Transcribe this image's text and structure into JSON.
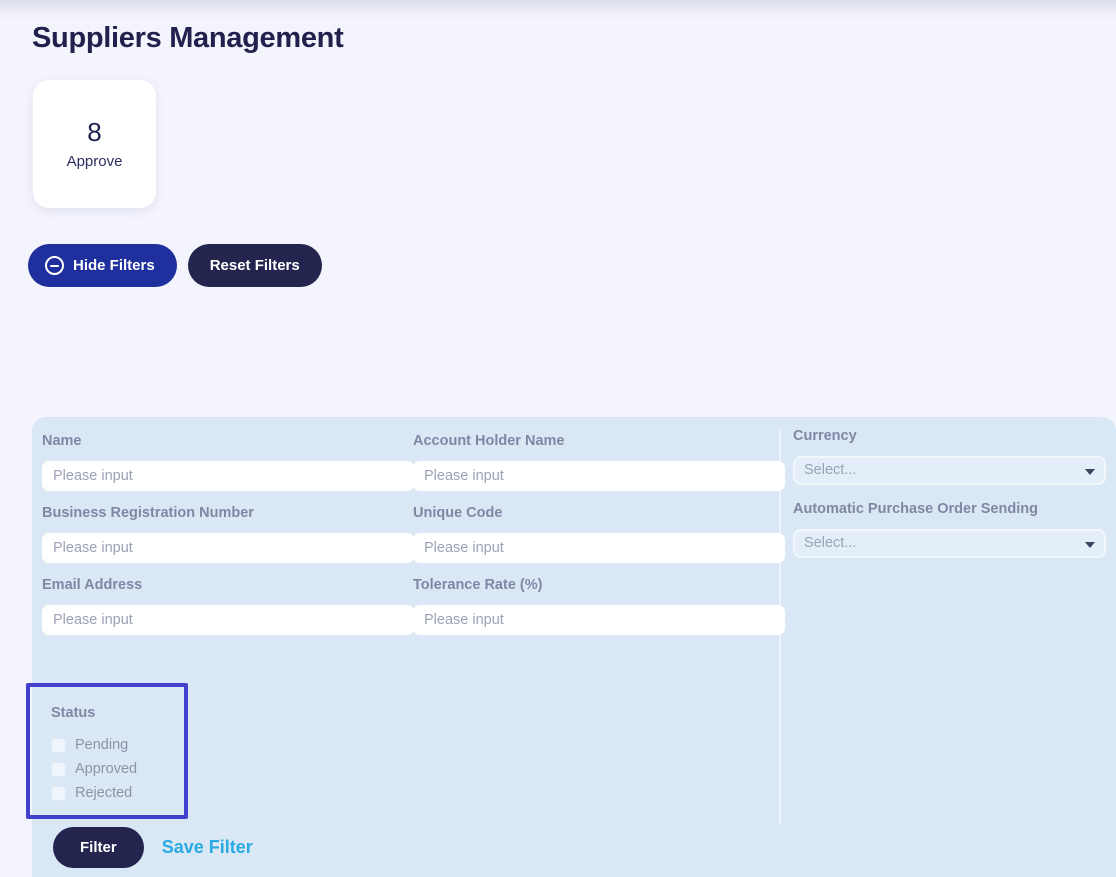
{
  "page": {
    "title": "Suppliers Management",
    "background_color": "#f4f4fd"
  },
  "stats": [
    {
      "value": "8",
      "label": "Approve"
    }
  ],
  "toolbar": {
    "hide_filters_label": "Hide Filters",
    "hide_filters_icon": "circle-minus-icon",
    "reset_filters_label": "Reset Filters",
    "hide_filters_color": "#1f2f9e",
    "reset_filters_color": "#23254f"
  },
  "filters": {
    "panel_color": "#dae8f6",
    "left_column": [
      {
        "label": "Name",
        "placeholder": "Please input",
        "value": ""
      },
      {
        "label": "Business Registration Number",
        "placeholder": "Please input",
        "value": ""
      },
      {
        "label": "Email Address",
        "placeholder": "Please input",
        "value": ""
      }
    ],
    "middle_column": [
      {
        "label": "Account Holder Name",
        "placeholder": "Please input",
        "value": ""
      },
      {
        "label": "Unique Code",
        "placeholder": "Please input",
        "value": ""
      },
      {
        "label": "Tolerance Rate (%)",
        "placeholder": "Please input",
        "value": ""
      }
    ],
    "right_column": [
      {
        "label": "Currency",
        "selected": "Select...",
        "icon": "chevron-down-icon"
      },
      {
        "label": "Automatic Purchase Order Sending",
        "selected": "Select...",
        "icon": "chevron-down-icon"
      }
    ],
    "status": {
      "label": "Status",
      "highlight_color": "#4141cd",
      "options": [
        {
          "label": "Pending",
          "checked": false
        },
        {
          "label": "Approved",
          "checked": false
        },
        {
          "label": "Rejected",
          "checked": false
        }
      ]
    },
    "actions": {
      "filter_label": "Filter",
      "save_filter_label": "Save Filter",
      "save_filter_color": "#29aae2"
    }
  }
}
